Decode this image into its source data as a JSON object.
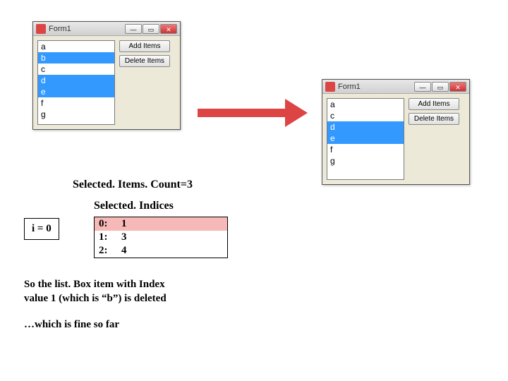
{
  "win1": {
    "title": "Form1",
    "items": [
      "a",
      "b",
      "c",
      "d",
      "e",
      "f",
      "g"
    ],
    "selected_indices": [
      1,
      3,
      4
    ],
    "buttons": {
      "add": "Add Items",
      "del": "Delete Items"
    }
  },
  "win2": {
    "title": "Form1",
    "items": [
      "a",
      "c",
      "d",
      "e",
      "f",
      "g"
    ],
    "selected_indices": [
      2,
      3
    ],
    "buttons": {
      "add": "Add Items",
      "del": "Delete Items"
    }
  },
  "count_line": "Selected. Items. Count=3",
  "indices": {
    "header": "Selected. Indices",
    "i_label": "i = 0",
    "rows": [
      {
        "k": "0:",
        "v": "1",
        "hl": true
      },
      {
        "k": "1:",
        "v": "3",
        "hl": false
      },
      {
        "k": "2:",
        "v": "4",
        "hl": false
      }
    ]
  },
  "explain1_l1": "So the list. Box item with Index",
  "explain1_l2": "value 1 (which is “b”) is deleted",
  "explain2": "…which is fine so far"
}
